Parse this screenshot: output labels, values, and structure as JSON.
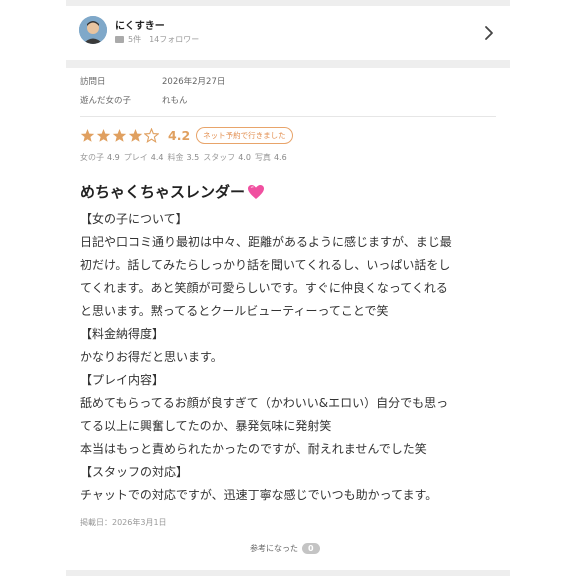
{
  "reviewer": {
    "name": "にくすきー",
    "review_count": "5件",
    "followers": "14フォロワー"
  },
  "visit": {
    "date_label": "訪問日",
    "date_value": "2026年2月27日",
    "girl_label": "遊んだ女の子",
    "girl_value": "れもん"
  },
  "rating": {
    "score": "4.2",
    "stars_filled": 4,
    "stars_total": 5,
    "badge": "ネット予約で行きました",
    "star_color": "#e0a060"
  },
  "subratings": [
    {
      "label": "女の子",
      "value": "4.9"
    },
    {
      "label": "プレイ",
      "value": "4.4"
    },
    {
      "label": "料金",
      "value": "3.5"
    },
    {
      "label": "スタッフ",
      "value": "4.0"
    },
    {
      "label": "写真",
      "value": "4.6"
    }
  ],
  "review": {
    "title": "めちゃくちゃスレンダー",
    "title_icon": "heart-icon",
    "lines": [
      "【女の子について】",
      "日記や口コミ通り最初は中々、距離があるように感じますが、まじ最",
      "初だけ。話してみたらしっかり話を聞いてくれるし、いっぱい話をし",
      "てくれます。あと笑顔が可愛らしいです。すぐに仲良くなってくれる",
      "と思います。黙ってるとクールビューティーってことで笑",
      "【料金納得度】",
      "かなりお得だと思います。",
      "【プレイ内容】",
      "舐めてもらってるお顔が良すぎて（かわいい&エロい）自分でも思っ",
      "てる以上に興奮してたのか、暴発気味に発射笑",
      "本当はもっと責められたかったのですが、耐えれませんでした笑",
      "【スタッフの対応】",
      "チャットでの対応ですが、迅速丁寧な感じでいつも助かってます。"
    ],
    "posted": "掲載日：2026年3月1日"
  },
  "helpful": {
    "label": "参考になった",
    "count": "0"
  }
}
